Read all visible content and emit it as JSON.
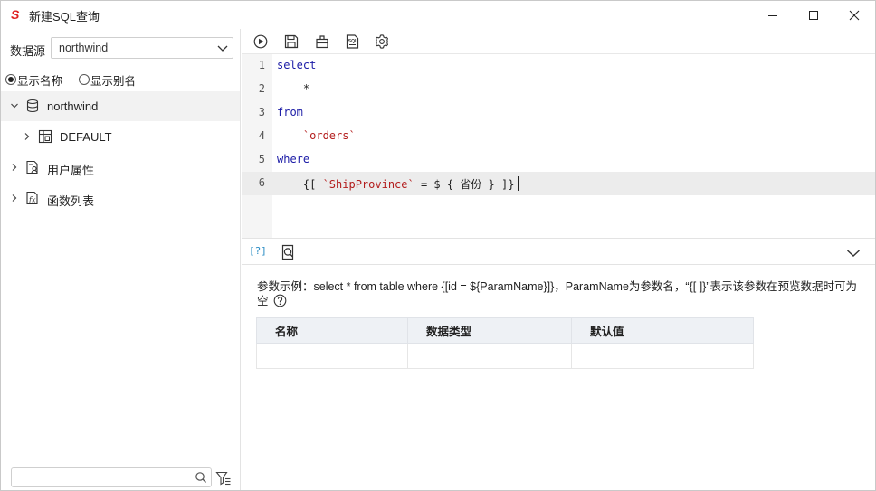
{
  "window": {
    "title": "新建SQL查询",
    "logo_letter": "S",
    "brand_color": "#e02020"
  },
  "sidebar": {
    "datasource_label": "数据源",
    "datasource_value": "northwind",
    "radio_show_name": "显示名称",
    "radio_show_alias": "显示别名",
    "selected_radio": "显示名称",
    "tree": [
      {
        "label": "northwind",
        "icon": "database-icon",
        "expanded": true
      },
      {
        "label": "DEFAULT",
        "icon": "schema-table-icon",
        "expanded": false
      },
      {
        "label": "用户属性",
        "icon": "user-property-icon",
        "expanded": false
      },
      {
        "label": "函数列表",
        "icon": "function-list-icon",
        "expanded": false
      }
    ],
    "search_placeholder": ""
  },
  "toolbar": {
    "buttons": [
      "run-icon",
      "save-icon",
      "clear-icon",
      "format-sql-icon",
      "settings-icon"
    ]
  },
  "editor": {
    "line_numbers": [
      "1",
      "2",
      "3",
      "4",
      "5",
      "6"
    ],
    "lines": {
      "l1_kw": "select",
      "l2": "    *",
      "l3_kw": "from",
      "l4_indent": "    ",
      "l4_str": "`orders`",
      "l5_kw": "where",
      "l6_a": "    {[ ",
      "l6_str": "`ShipProvince`",
      "l6_b": " = $ { 省份 } ]}"
    },
    "active_line": 6
  },
  "params": {
    "tab_label": "[?]",
    "hint": "参数示例：select * from table where {[id = ${ParamName}]}，ParamName为参数名，“{[ ]}”表示该参数在预览数据时可为空",
    "columns": [
      "名称",
      "数据类型",
      "默认值"
    ]
  }
}
